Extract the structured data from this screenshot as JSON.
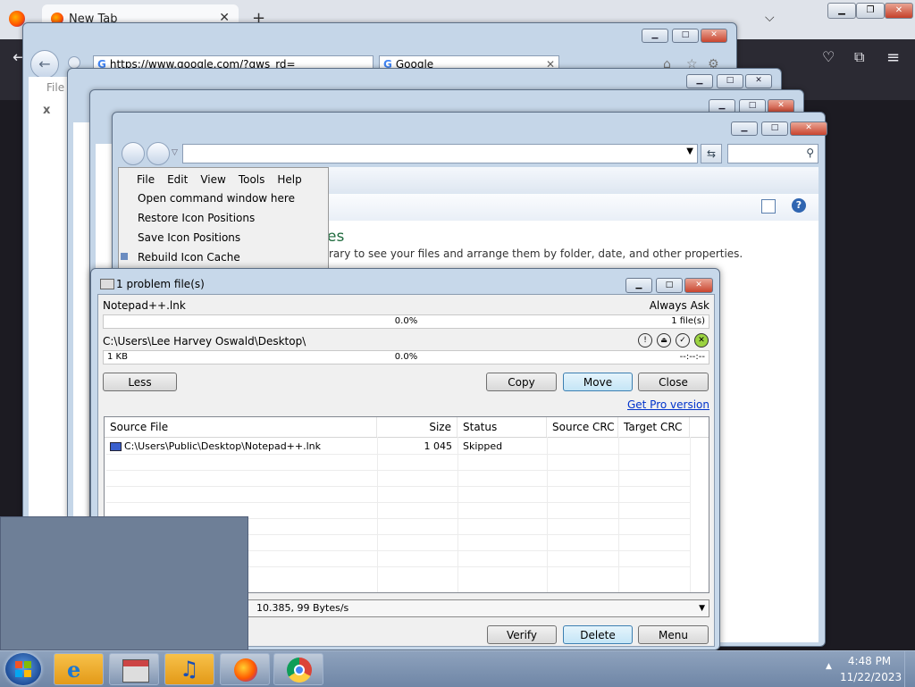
{
  "firefox": {
    "tab_title": "New Tab"
  },
  "ie_back": {
    "url": "https://www.google.com/?gws_rd=",
    "tab": "Google",
    "menu_file": "File",
    "close_x": "x"
  },
  "explorer": {
    "menu_bar": [
      "File",
      "Edit",
      "View",
      "Tools",
      "Help"
    ],
    "context_items": [
      "Open command window here",
      "Restore Icon Positions",
      "Save Icon Positions",
      "Rebuild Icon Cache"
    ],
    "libraries_title_fragment": "es",
    "libraries_desc_fragment": "rary to see your files and arrange them by folder, date, and other properties."
  },
  "dialog": {
    "title": "1 problem file(s)",
    "file_name": "Notepad++.lnk",
    "mode": "Always Ask",
    "bar1_percent": "0.0%",
    "bar1_right": "1 file(s)",
    "path": "C:\\Users\\Lee Harvey Oswald\\Desktop\\",
    "bar2_left": "1 KB",
    "bar2_percent": "0.0%",
    "bar2_right": "--:--:--",
    "buttons": {
      "less": "Less",
      "copy": "Copy",
      "move": "Move",
      "close": "Close",
      "verify": "Verify",
      "delete": "Delete",
      "menu": "Menu"
    },
    "pro_link": "Get Pro version",
    "columns": [
      "Source File",
      "Size",
      "Status",
      "Source CRC",
      "Target CRC"
    ],
    "rows": [
      {
        "source": "C:\\Users\\Public\\Desktop\\Notepad++.lnk",
        "size": "1 045",
        "status": "Skipped",
        "src_crc": "",
        "tgt_crc": ""
      }
    ],
    "speed": "10.385, 99 Bytes/s"
  },
  "taskbar": {
    "time": "4:48 PM",
    "date": "11/22/2023"
  }
}
